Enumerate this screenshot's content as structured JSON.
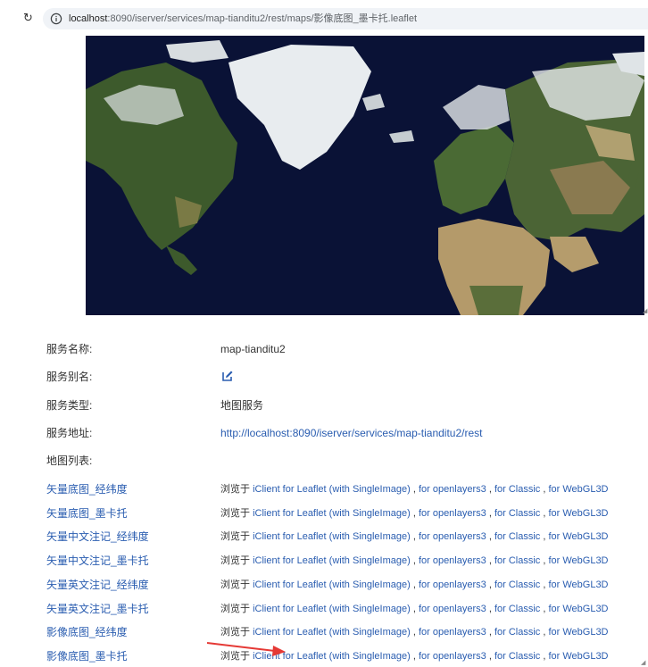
{
  "browser": {
    "url_host": "localhost",
    "url_rest": ":8090/iserver/services/map-tianditu2/rest/maps/影像底图_墨卡托.leaflet"
  },
  "map": {
    "colors": {
      "ocean": "#0a1236",
      "land": "#3d5a2c",
      "desert": "#b49a6a",
      "ice": "#e8ecef"
    }
  },
  "info": {
    "service_name_label": "服务名称:",
    "service_name_value": "map-tianditu2",
    "service_alias_label": "服务别名:",
    "service_type_label": "服务类型:",
    "service_type_value": "地图服务",
    "service_address_label": "服务地址:",
    "service_address_value": "http://localhost:8090/iserver/services/map-tianditu2/rest",
    "map_list_label": "地图列表:"
  },
  "map_list": {
    "browse_prefix": "浏览于",
    "link_leaflet": "iClient for Leaflet (with SingleImage)",
    "link_openlayers": "for openlayers3",
    "link_classic": "for Classic",
    "link_webgl": "for WebGL3D",
    "separator": " , ",
    "items": [
      {
        "name": "矢量底图_经纬度"
      },
      {
        "name": "矢量底图_墨卡托"
      },
      {
        "name": "矢量中文注记_经纬度"
      },
      {
        "name": "矢量中文注记_墨卡托"
      },
      {
        "name": "矢量英文注记_经纬度"
      },
      {
        "name": "矢量英文注记_墨卡托"
      },
      {
        "name": "影像底图_经纬度"
      },
      {
        "name": "影像底图_墨卡托"
      }
    ]
  },
  "colors": {
    "link": "#2a5db0",
    "arrow": "#e53935"
  }
}
